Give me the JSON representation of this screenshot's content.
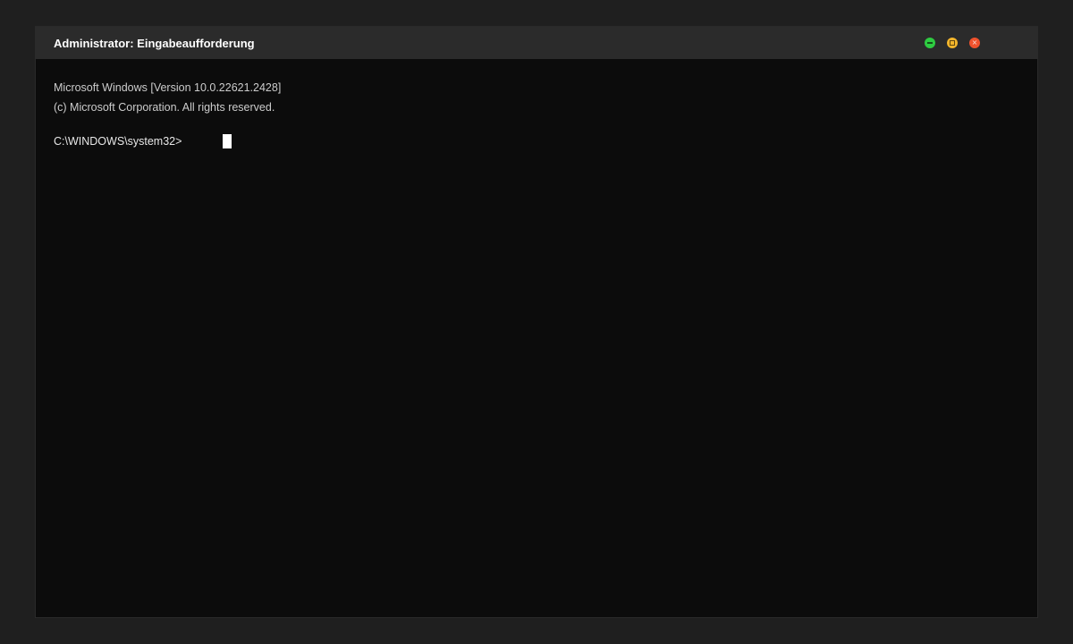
{
  "window": {
    "title": "Administrator: Eingabeaufforderung",
    "controls": {
      "minimize": "minimize-icon",
      "maximize": "maximize-icon",
      "close": "close-icon"
    },
    "colors": {
      "minimize": "#2ecb41",
      "maximize": "#f2b52c",
      "close": "#f0522d"
    }
  },
  "terminal": {
    "lines": [
      "Microsoft Windows [Version 10.0.22621.2428]",
      "(c) Microsoft Corporation. All rights reserved."
    ],
    "prompt": "C:\\WINDOWS\\system32>",
    "input": ""
  }
}
